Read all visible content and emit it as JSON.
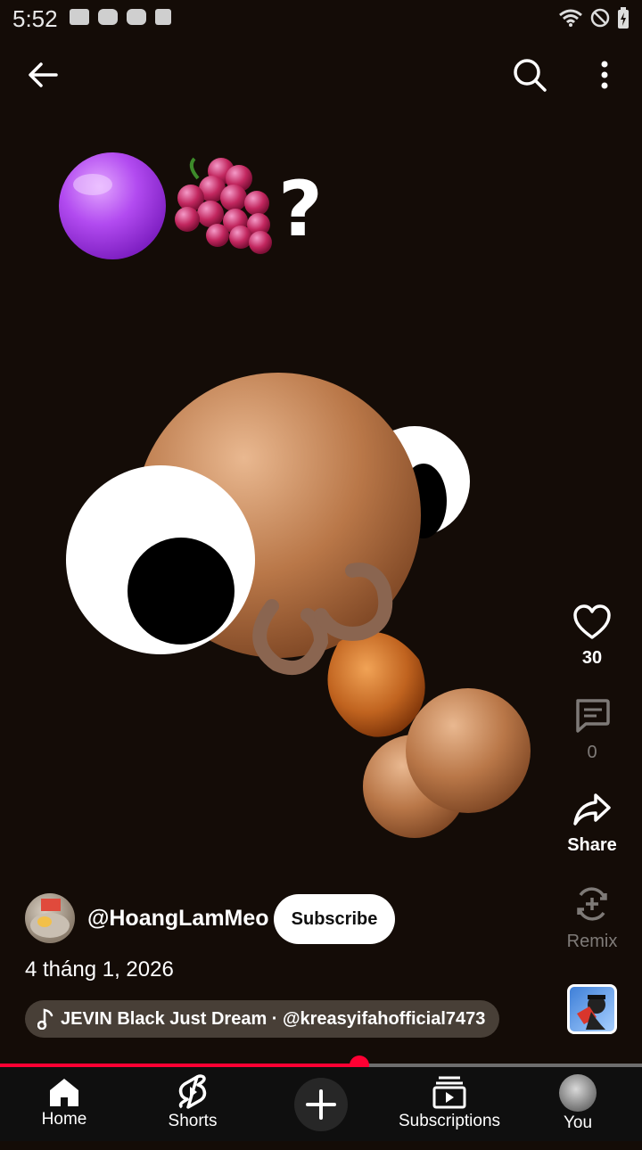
{
  "status_bar": {
    "time": "5:52"
  },
  "video": {
    "overlay_text": "?"
  },
  "actions": {
    "like_count": "30",
    "comment_count": "0",
    "share_label": "Share",
    "remix_label": "Remix"
  },
  "channel": {
    "handle": "@HoangLamMeo",
    "subscribe_label": "Subscribe",
    "date": "4 tháng 1, 2026"
  },
  "music": {
    "text": "JEVIN Black Just Dream · @kreasyifahofficial7473"
  },
  "progress": {
    "fraction": 0.56
  },
  "bottom_nav": [
    {
      "label": "Home"
    },
    {
      "label": "Shorts"
    },
    {
      "label": "Subscriptions"
    },
    {
      "label": "You"
    }
  ],
  "colors": {
    "accent": "#ff0033",
    "background": "#140c07"
  }
}
